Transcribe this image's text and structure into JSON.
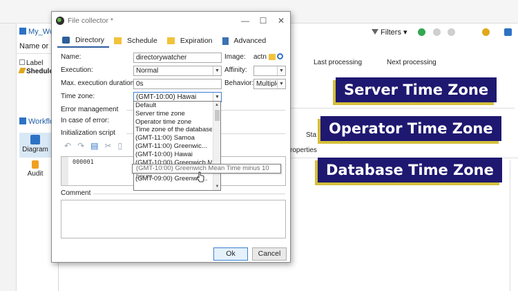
{
  "background": {
    "left_tab": "My_Wo",
    "name_column": "Name or",
    "tree": [
      "Label",
      "Sheduler"
    ],
    "workflow_tab": "Workflo",
    "sidebar": [
      {
        "label": "Diagram",
        "icon": "diagram-icon"
      },
      {
        "label": "Audit",
        "icon": "audit-icon"
      }
    ],
    "filters_label": "Filters",
    "columns": [
      "Last processing",
      "Next processing"
    ],
    "sta_text": "Sta",
    "properties_text": "roperties"
  },
  "dialog": {
    "title": "File collector *",
    "tabs": [
      {
        "label": "Directory",
        "icon": "briefcase-icon"
      },
      {
        "label": "Schedule",
        "icon": "folder-icon"
      },
      {
        "label": "Expiration",
        "icon": "folder-icon"
      },
      {
        "label": "Advanced",
        "icon": "clipboard-icon"
      }
    ],
    "fields": {
      "name_label": "Name:",
      "name_value": "directorywatcher",
      "execution_label": "Execution:",
      "execution_value": "Normal",
      "max_duration_label": "Max. execution duration:",
      "max_duration_value": "0s",
      "timezone_label": "Time zone:",
      "timezone_value": "(GMT-10:00) Hawai",
      "image_label": "Image:",
      "image_value": "actn",
      "affinity_label": "Affinity:",
      "affinity_value": "",
      "behavior_label": "Behavior:",
      "behavior_value": "Multiple"
    },
    "error_management_label": "Error management",
    "in_case_of_error_label": "In case of error:",
    "init_script_label": "Initialization script",
    "script_line": "000001",
    "comment_label": "Comment",
    "ok_label": "Ok",
    "cancel_label": "Cancel"
  },
  "timezone_options": [
    "Default",
    "Server time zone",
    "Operator time zone",
    "Time zone of the database",
    "(GMT-11:00) Samoa",
    "(GMT-11:00) Greenwic...",
    "(GMT-10:00) Hawai",
    "(GMT-10:00) Greenwich Mean Time minus 10 hours",
    "(GMT-09:00) Alaska",
    "(GMT-09:00) Greenwic..."
  ],
  "tooltip": "(GMT-10:00) Greenwich Mean Time minus 10 hours",
  "captions": [
    "Server Time Zone",
    "Operator Time Zone",
    "Database Time Zone"
  ],
  "colors": {
    "caption_bg": "#1f1870",
    "caption_shadow": "#d4bf3a",
    "accent_blue": "#2b5d9c",
    "ok_border": "#3c7fd3"
  }
}
